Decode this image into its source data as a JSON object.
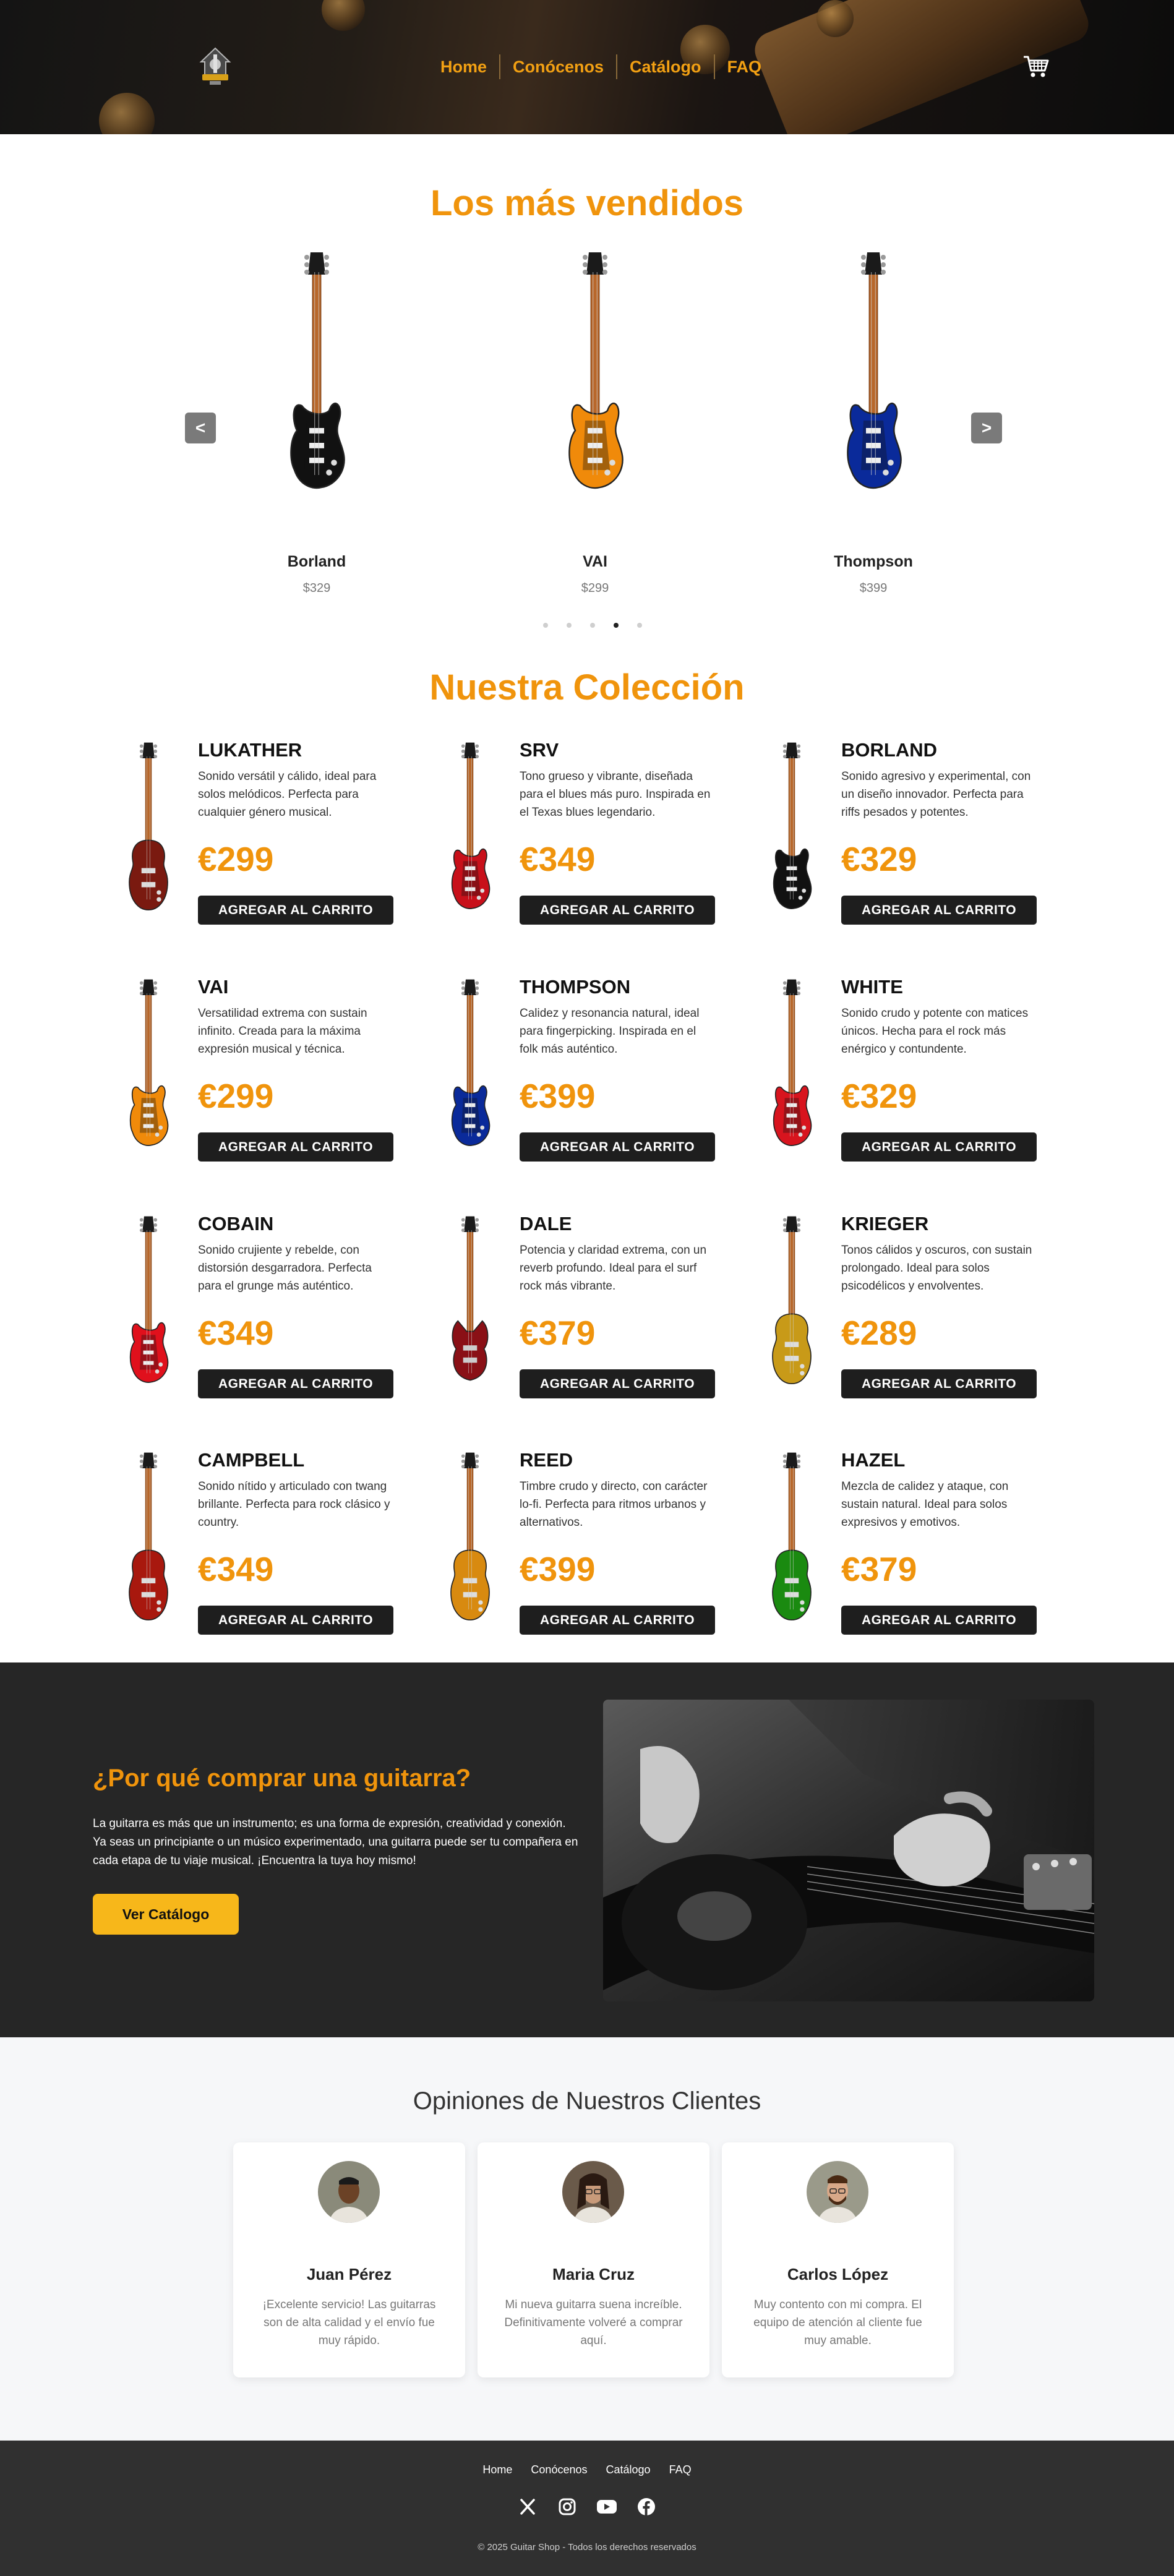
{
  "header": {
    "nav": [
      {
        "label": "Home"
      },
      {
        "label": "Conócenos"
      },
      {
        "label": "Catálogo"
      },
      {
        "label": "FAQ"
      }
    ],
    "cart_icon": "cart-icon",
    "logo_icon": "guitar-shop-logo"
  },
  "bestsellers": {
    "title": "Los más vendidos",
    "prev_label": "<",
    "next_label": ">",
    "items": [
      {
        "name": "Borland",
        "price": "$329",
        "color": "#111111"
      },
      {
        "name": "VAI",
        "price": "$299",
        "color": "#f08a0a"
      },
      {
        "name": "Thompson",
        "price": "$399",
        "color": "#0a2a9a"
      }
    ],
    "dots_total": 5,
    "active_dot": 4
  },
  "collection": {
    "title": "Nuestra Colección",
    "button_label": "AGREGAR AL CARRITO",
    "products": [
      {
        "name": "LUKATHER",
        "desc": "Sonido versátil y cálido, ideal para solos melódicos. Perfecta para cualquier género musical.",
        "price": "€299",
        "color": "#7a1a10"
      },
      {
        "name": "SRV",
        "desc": "Tono grueso y vibrante, diseñada para el blues más puro. Inspirada en el Texas blues legendario.",
        "price": "€349",
        "color": "#c8101a"
      },
      {
        "name": "BORLAND",
        "desc": "Sonido agresivo y experimental, con un diseño innovador. Perfecta para riffs pesados y potentes.",
        "price": "€329",
        "color": "#111111"
      },
      {
        "name": "VAI",
        "desc": "Versatilidad extrema con sustain infinito. Creada para la máxima expresión musical y técnica.",
        "price": "€299",
        "color": "#f08a0a"
      },
      {
        "name": "THOMPSON",
        "desc": "Calidez y resonancia natural, ideal para fingerpicking. Inspirada en el folk más auténtico.",
        "price": "€399",
        "color": "#0a2a9a"
      },
      {
        "name": "WHITE",
        "desc": "Sonido crudo y potente con matices únicos. Hecha para el rock más enérgico y contundente.",
        "price": "€329",
        "color": "#d8141e"
      },
      {
        "name": "COBAIN",
        "desc": "Sonido crujiente y rebelde, con distorsión desgarradora. Perfecta para el grunge más auténtico.",
        "price": "€349",
        "color": "#e0101c"
      },
      {
        "name": "DALE",
        "desc": "Potencia y claridad extrema, con un reverb profundo. Ideal para el surf rock más vibrante.",
        "price": "€379",
        "color": "#8a1016"
      },
      {
        "name": "KRIEGER",
        "desc": "Tonos cálidos y oscuros, con sustain prolongado. Ideal para solos psicodélicos y envolventes.",
        "price": "€289",
        "color": "#c89a18"
      },
      {
        "name": "CAMPBELL",
        "desc": "Sonido nítido y articulado con twang brillante. Perfecta para rock clásico y country.",
        "price": "€349",
        "color": "#a8180e"
      },
      {
        "name": "REED",
        "desc": "Timbre crudo y directo, con carácter lo-fi. Perfecta para ritmos urbanos y alternativos.",
        "price": "€399",
        "color": "#d88a10"
      },
      {
        "name": "HAZEL",
        "desc": "Mezcla de calidez y ataque, con sustain natural. Ideal para solos expresivos y emotivos.",
        "price": "€379",
        "color": "#1a8a10"
      }
    ]
  },
  "why": {
    "title": "¿Por qué comprar una guitarra?",
    "text": "La guitarra es más que un instrumento; es una forma de expresión, creatividad y conexión. Ya seas un principiante o un músico experimentado, una guitarra puede ser tu compañera en cada etapa de tu viaje musical. ¡Encuentra la tuya hoy mismo!",
    "button": "Ver Catálogo"
  },
  "testimonials": {
    "title": "Opiniones de Nuestros Clientes",
    "items": [
      {
        "name": "Juan Pérez",
        "text": "¡Excelente servicio! Las guitarras son de alta calidad y el envío fue muy rápido.",
        "skin": "#6b4226",
        "bg": "#8a8a7a"
      },
      {
        "name": "Maria Cruz",
        "text": "Mi nueva guitarra suena increíble. Definitivamente volveré a comprar aquí.",
        "skin": "#c89a7a",
        "bg": "#6a5a4a"
      },
      {
        "name": "Carlos López",
        "text": "Muy contento con mi compra. El equipo de atención al cliente fue muy amable.",
        "skin": "#d8a888",
        "bg": "#9a9a8a"
      }
    ]
  },
  "footer": {
    "nav": [
      {
        "label": "Home"
      },
      {
        "label": "Conócenos"
      },
      {
        "label": "Catálogo"
      },
      {
        "label": "FAQ"
      }
    ],
    "social_icons": [
      "x-icon",
      "instagram-icon",
      "youtube-icon",
      "facebook-icon"
    ],
    "copyright": "© 2025 Guitar Shop - Todos los derechos reservados"
  }
}
